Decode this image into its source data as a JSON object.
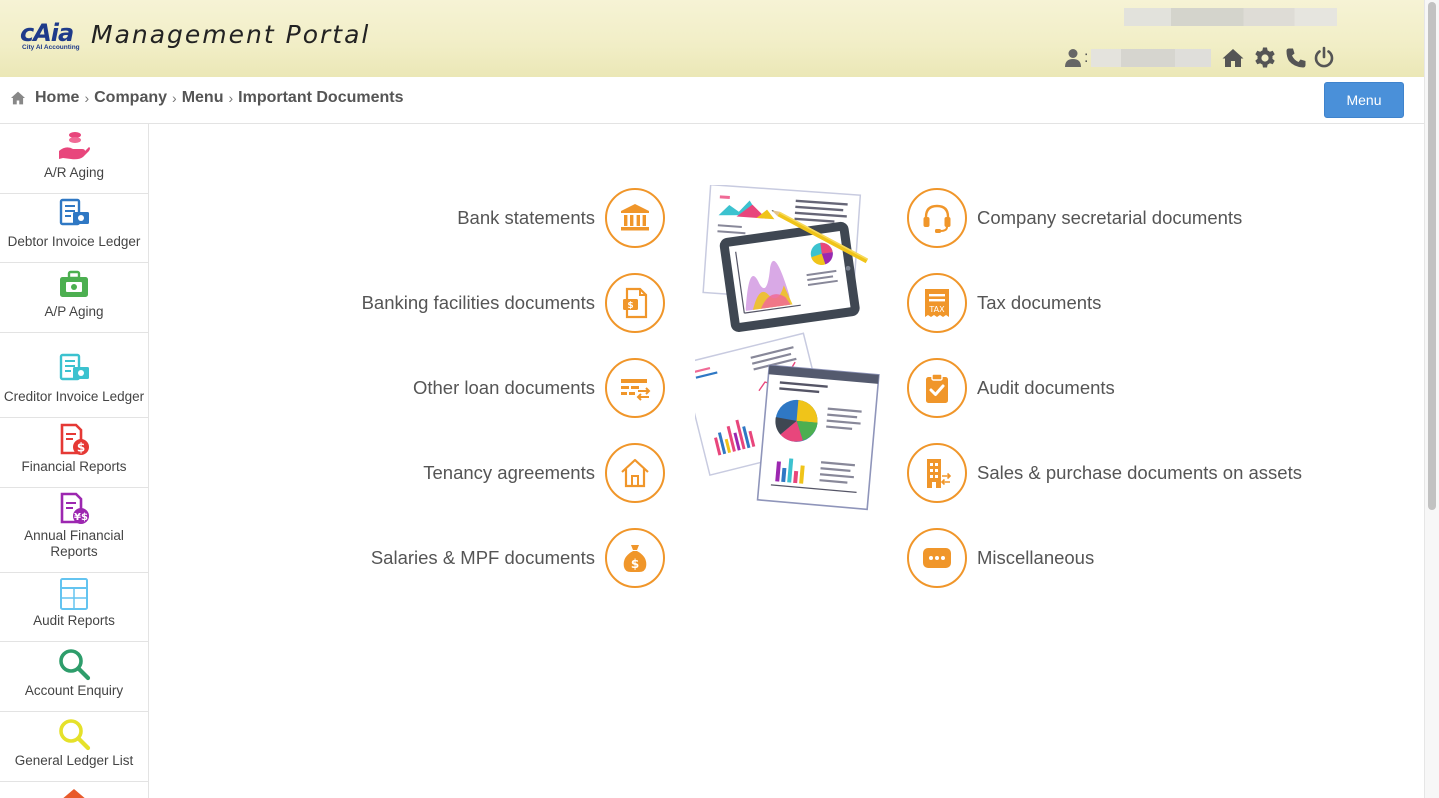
{
  "header": {
    "logo_text": "cAia",
    "logo_subtitle": "City AI Accounting",
    "title": "Management Portal",
    "user_colon": ":",
    "icons": [
      "user-icon",
      "home-icon",
      "gear-icon",
      "phone-icon",
      "power-icon"
    ]
  },
  "breadcrumb": {
    "items": [
      "Home",
      "Company",
      "Menu",
      "Important Documents"
    ],
    "separator": "›",
    "menu_button": "Menu"
  },
  "sidebar": {
    "items": [
      {
        "label": "A/R Aging",
        "icon": "hand-coins-icon",
        "color": "#e8467c"
      },
      {
        "label": "Debtor Invoice Ledger",
        "icon": "invoice-ledger-icon",
        "color": "#2f78c4"
      },
      {
        "label": "A/P Aging",
        "icon": "briefcase-cash-icon",
        "color": "#4caf50"
      },
      {
        "label": "Creditor Invoice Ledger",
        "icon": "invoice-ledger-icon",
        "color": "#3cc2cf"
      },
      {
        "label": "Financial Reports",
        "icon": "report-dollar-icon",
        "color": "#e53935"
      },
      {
        "label": "Annual Financial Reports",
        "icon": "report-yen-icon",
        "color": "#9c27b0"
      },
      {
        "label": "Audit Reports",
        "icon": "calculator-icon",
        "color": "#64c4f0"
      },
      {
        "label": "Account Enquiry",
        "icon": "magnifier-icon",
        "color": "#2e9d6b"
      },
      {
        "label": "General Ledger List",
        "icon": "magnifier-icon",
        "color": "#e5e12a"
      }
    ]
  },
  "documents": {
    "left": [
      {
        "label": "Bank statements",
        "icon": "bank-icon"
      },
      {
        "label": "Banking facilities documents",
        "icon": "dollar-file-icon"
      },
      {
        "label": "Other loan documents",
        "icon": "loan-transfer-icon"
      },
      {
        "label": "Tenancy agreements",
        "icon": "house-icon"
      },
      {
        "label": "Salaries & MPF documents",
        "icon": "money-bag-icon"
      }
    ],
    "right": [
      {
        "label": "Company secretarial documents",
        "icon": "headset-icon"
      },
      {
        "label": "Tax documents",
        "icon": "tax-receipt-icon"
      },
      {
        "label": "Audit documents",
        "icon": "clipboard-check-icon"
      },
      {
        "label": "Sales & purchase documents on assets",
        "icon": "building-icon"
      },
      {
        "label": "Miscellaneous",
        "icon": "chat-dots-icon"
      }
    ],
    "accent_color": "#f0962a"
  }
}
